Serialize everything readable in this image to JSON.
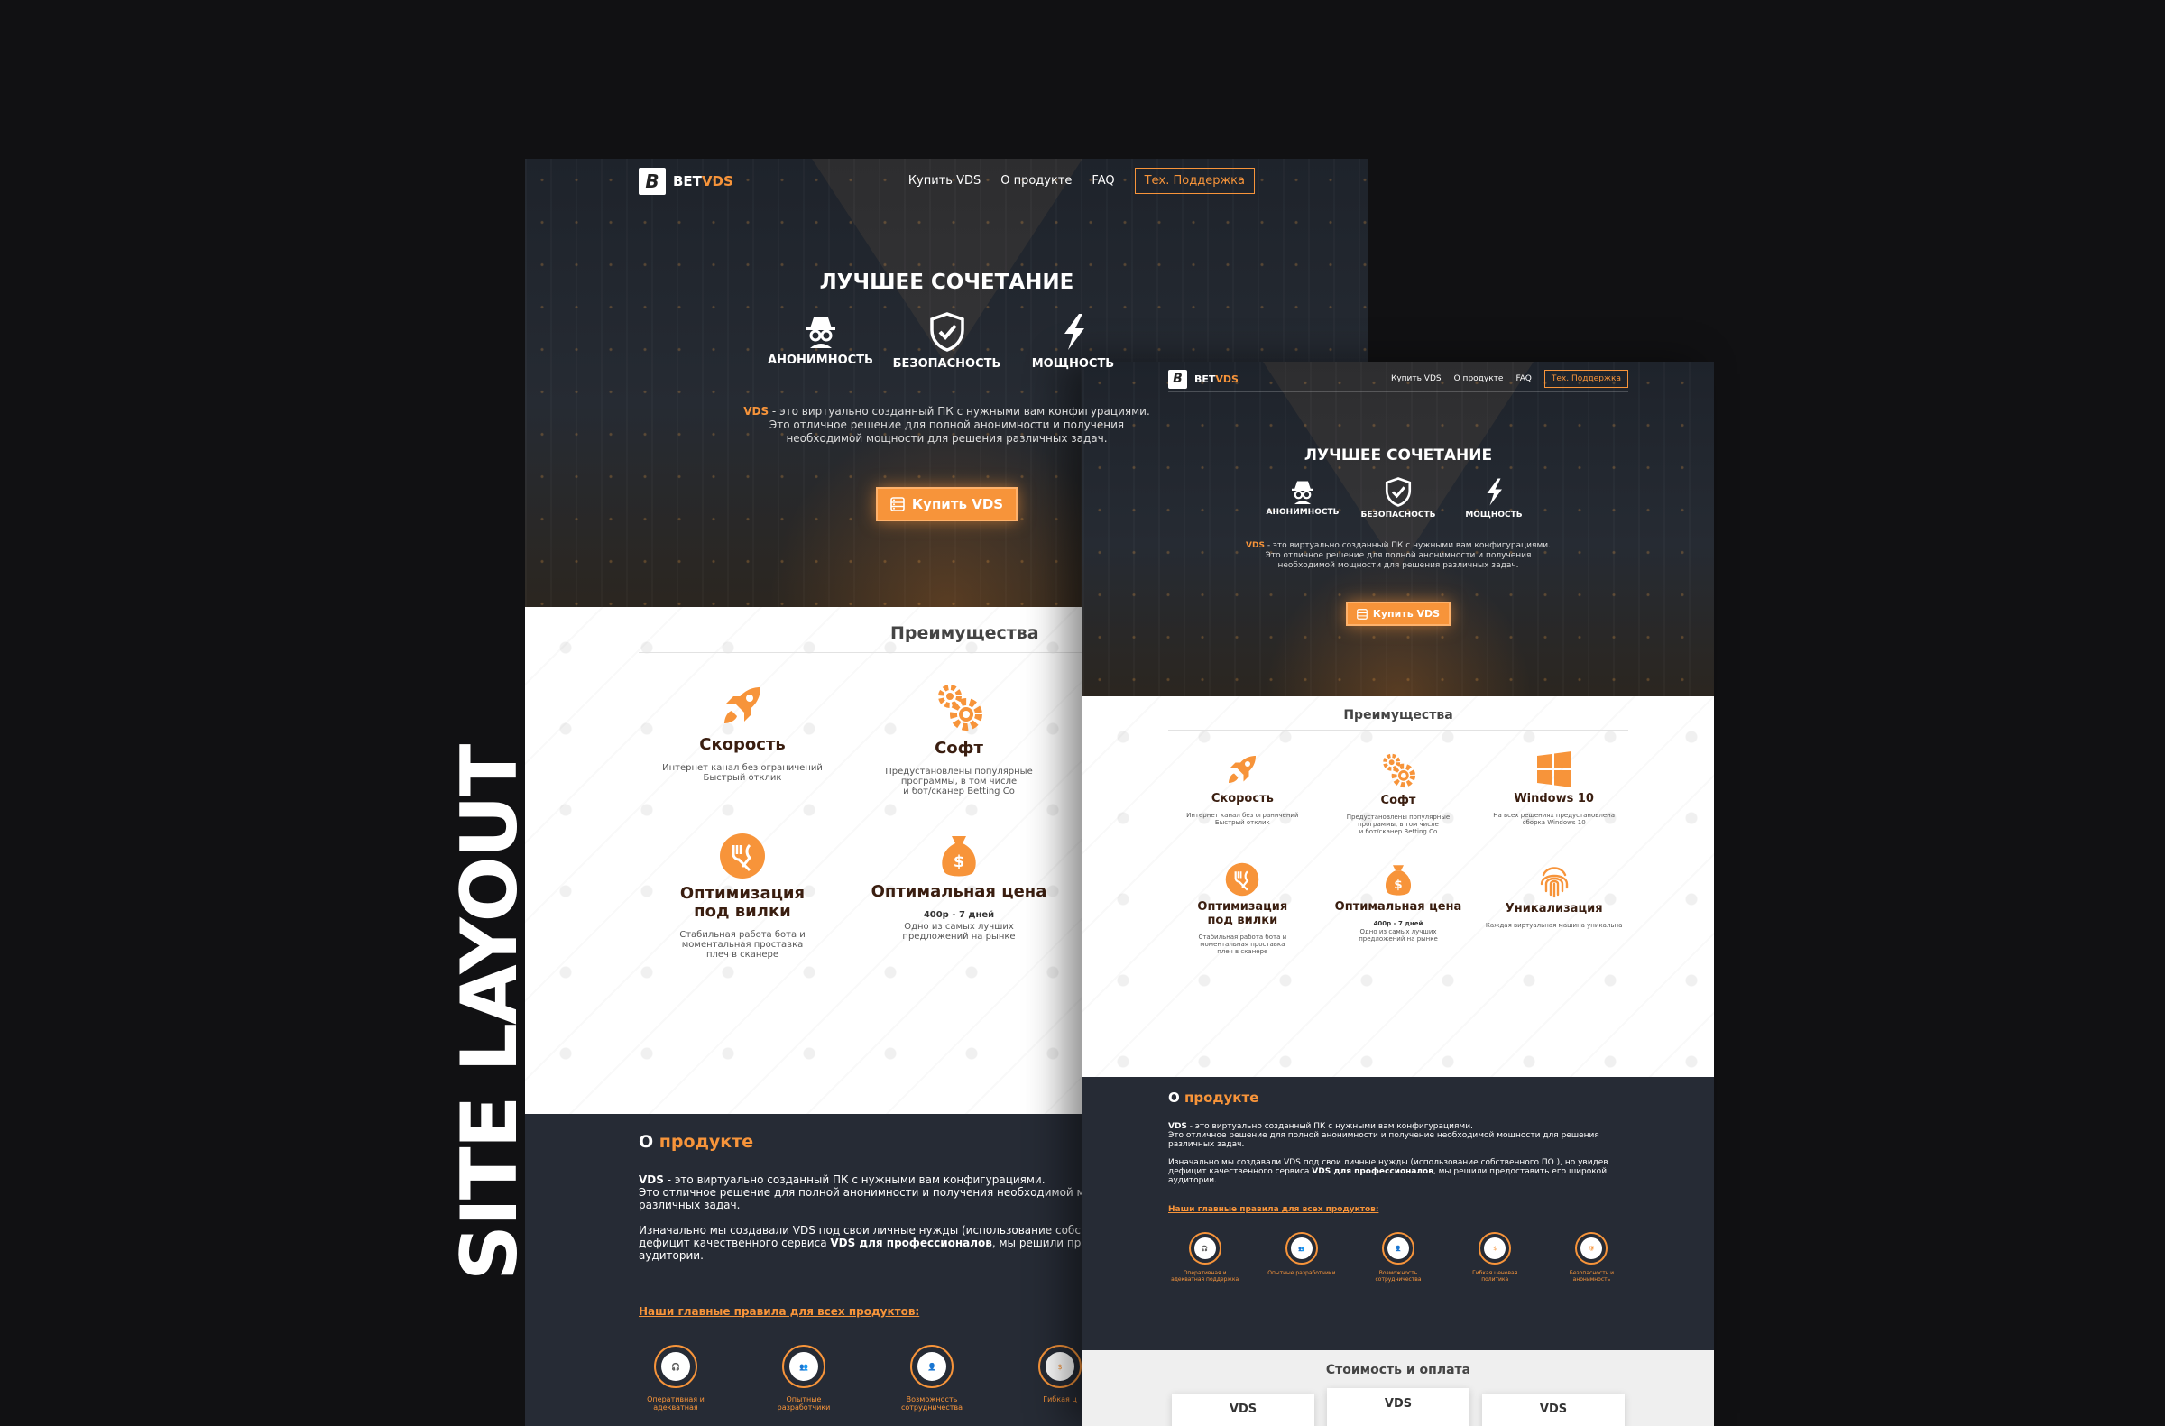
{
  "vertical_title": "SITE LAYOUT",
  "brand": {
    "logo_letter": "B",
    "name_part1": "BET",
    "name_part2": "VDS"
  },
  "nav": {
    "links": [
      "Купить VDS",
      "О продукте",
      "FAQ"
    ],
    "support": "Тех. Поддержка"
  },
  "hero": {
    "title": "ЛУЧШЕЕ СОЧЕТАНИЕ",
    "features": [
      "АНОНИМНОСТЬ",
      "БЕЗОПАСНОСТЬ",
      "МОЩНОСТЬ"
    ],
    "vds_word": "VDS",
    "text_line1": " - это виртуально созданный ПК с нужными вам конфигурациями.",
    "text_line2": "Это отличное решение для полной анонимности и получения",
    "text_line3": "необходимой мощности для решения различных задач.",
    "buy_button": "Купить VDS"
  },
  "benefits": {
    "title": "Преимущества",
    "cards": [
      {
        "title": "Скорость",
        "desc_line1": "Интернет канал без ограничений",
        "desc_line2": "Быстрый отклик",
        "desc_line3": "",
        "icon": "rocket-icon"
      },
      {
        "title": "Софт",
        "desc_line1": "Предустановлены популярные",
        "desc_line2": "программы, в том числе",
        "desc_line3": "и бот/сканер Betting Co",
        "icon": "gears-icon"
      },
      {
        "title": "Windows 10",
        "desc_line1": "На всех решениях предустановлена",
        "desc_line2": "сборка Windows 10",
        "desc_line3": "",
        "icon": "windows-icon"
      },
      {
        "title_line1": "Оптимизация",
        "title_line2": "под вилки",
        "desc_line1": "Стабильная работа бота и",
        "desc_line2": "моментальная проставка",
        "desc_line3": "плеч в сканере",
        "icon": "fork-icon"
      },
      {
        "title": "Оптимальная цена",
        "price": "400р - 7 дней",
        "desc_line1": "Одно из самых лучших",
        "desc_line2": "предложений на рынке",
        "icon": "money-bag-icon"
      },
      {
        "title": "Уникализация",
        "desc_line1": "Каждая виртуальная машина уникальна",
        "icon": "fingerprint-icon"
      }
    ]
  },
  "about": {
    "title_part1": "О ",
    "title_part2": "продукте",
    "p1_vds": "VDS",
    "p1_rest": " - это виртуально созданный ПК с нужными вам конфигурациями.",
    "p1_line2": "Это отличное решение для полной анонимности и получение необходимой мощности для решения",
    "p1_line3": "различных задач.",
    "p2_start": "Изначально мы создавали VDS под свои личные нужды (использование собственного ПО ), но увидев",
    "p2_mid": "дефицит качественного сервиса ",
    "p2_bold": "VDS для профессионалов",
    "p2_end": ", мы решили предоставить его широкой",
    "p2_line3": "аудитории.",
    "m1_p1_line2": "Это отличное решение для полной анонимности и получения необходимой мо",
    "m1_p2_start": "Изначально мы создавали VDS под свои личные нужды (использование собстве",
    "m1_p2_end": ", мы решили предос",
    "rules_title": "Наши главные правила для всех продуктов:",
    "rules": [
      {
        "label": "Оперативная и адекватная поддержка",
        "icon": "headset-icon"
      },
      {
        "label": "Опытные разработчики",
        "icon": "team-icon"
      },
      {
        "label": "Возможность сотрудничества",
        "icon": "partner-icon"
      },
      {
        "label": "Гибкая ценовая политика",
        "icon": "price-icon"
      },
      {
        "label": "Безопасность и анонимность",
        "icon": "shield-mask-icon"
      }
    ],
    "m1_rules": [
      "Оперативная и адекватная",
      "Опытные разработчики",
      "Возможность сотрудничества",
      "Гибкая ц"
    ]
  },
  "pricing": {
    "title": "Стоимость и оплата",
    "cards": [
      "VDS",
      "VDS",
      "VDS"
    ]
  },
  "colors": {
    "accent": "#f7943a",
    "dark_bg": "#262b35",
    "page_bg": "#111113"
  }
}
